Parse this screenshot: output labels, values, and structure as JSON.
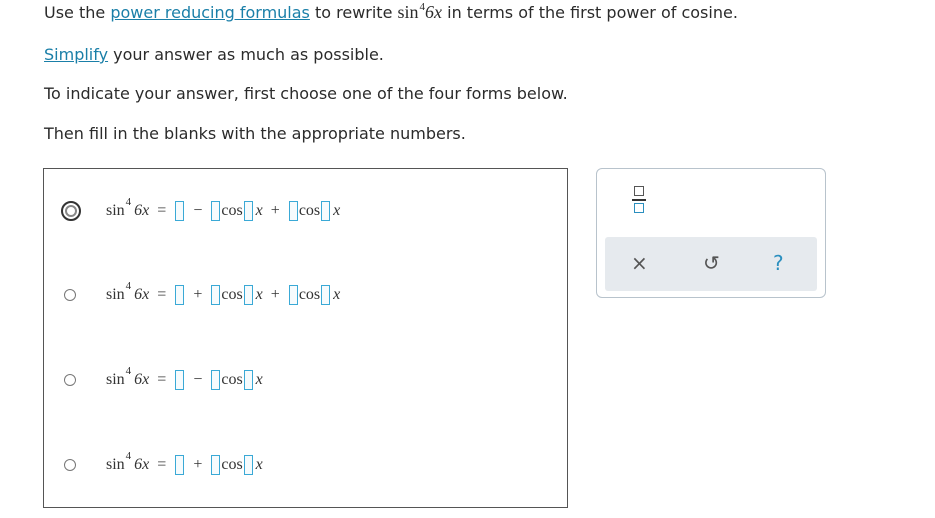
{
  "instructions": {
    "line1": {
      "pre": "Use the ",
      "link": "power reducing formulas",
      "mid": " to rewrite ",
      "fn": "sin",
      "exp": "4",
      "arg": "6x",
      "post": " in terms of the first power of cosine."
    },
    "line2": {
      "link": "Simplify",
      "post": " your answer as much as possible."
    },
    "line3": "To indicate your answer, first choose one of the four forms below.",
    "line4": "Then fill in the blanks with the appropriate numbers."
  },
  "choices": [
    {
      "selected": true,
      "lhs_fn": "sin",
      "lhs_exp": "4",
      "lhs_arg": "6x",
      "eq": "=",
      "ops": [
        "−",
        "+"
      ],
      "cos": "cos",
      "var": "x"
    },
    {
      "selected": false,
      "lhs_fn": "sin",
      "lhs_exp": "4",
      "lhs_arg": "6x",
      "eq": "=",
      "ops": [
        "+",
        "+"
      ],
      "cos": "cos",
      "var": "x"
    },
    {
      "selected": false,
      "lhs_fn": "sin",
      "lhs_exp": "4",
      "lhs_arg": "6x",
      "eq": "=",
      "ops": [
        "−"
      ],
      "cos": "cos",
      "var": "x"
    },
    {
      "selected": false,
      "lhs_fn": "sin",
      "lhs_exp": "4",
      "lhs_arg": "6x",
      "eq": "=",
      "ops": [
        "+"
      ],
      "cos": "cos",
      "var": "x"
    }
  ],
  "toolbox": {
    "fraction_icon": "fraction-icon",
    "clear": "×",
    "undo": "↺",
    "help": "?"
  }
}
